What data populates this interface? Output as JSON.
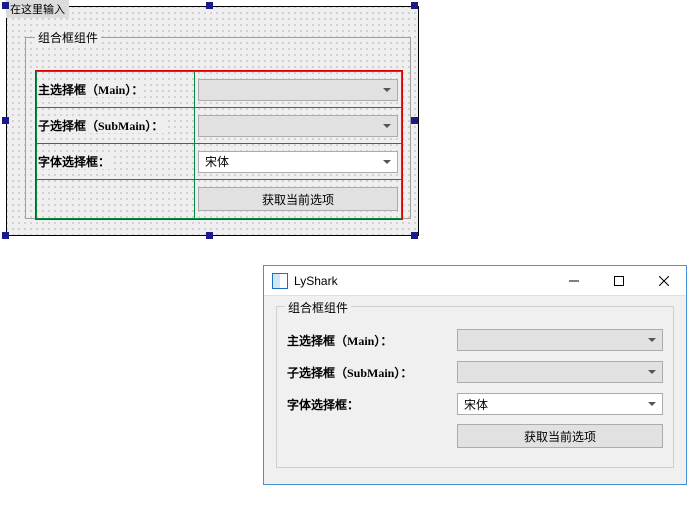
{
  "designer": {
    "placeholder_text": "在这里输入",
    "groupbox_title": "组合框组件",
    "rows": {
      "main_label": "主选择框（Main）：",
      "sub_label": "子选择框（SubMain）：",
      "font_label": "字体选择框：",
      "font_value": "宋体",
      "button_label": "获取当前选项"
    }
  },
  "window": {
    "title": "LyShark",
    "groupbox_title": "组合框组件",
    "rows": {
      "main_label": "主选择框（Main）：",
      "sub_label": "子选择框（SubMain）：",
      "font_label": "字体选择框：",
      "font_value": "宋体",
      "button_label": "获取当前选项"
    }
  }
}
